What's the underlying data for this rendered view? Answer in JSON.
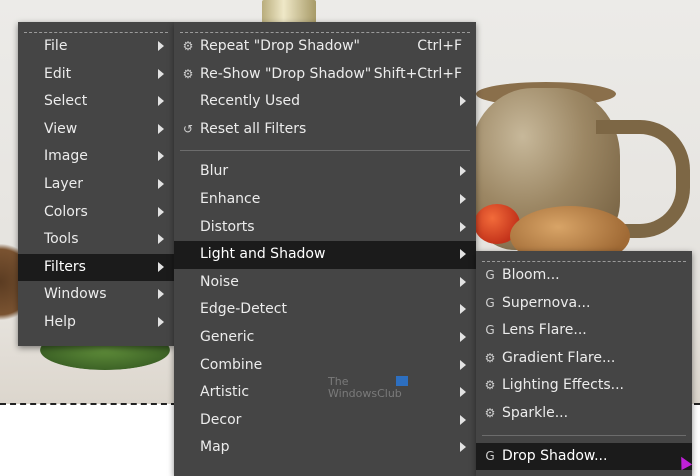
{
  "main_menu": {
    "items": [
      {
        "label": "File",
        "submenu": true
      },
      {
        "label": "Edit",
        "submenu": true
      },
      {
        "label": "Select",
        "submenu": true
      },
      {
        "label": "View",
        "submenu": true
      },
      {
        "label": "Image",
        "submenu": true
      },
      {
        "label": "Layer",
        "submenu": true
      },
      {
        "label": "Colors",
        "submenu": true
      },
      {
        "label": "Tools",
        "submenu": true
      },
      {
        "label": "Filters",
        "submenu": true,
        "active": true
      },
      {
        "label": "Windows",
        "submenu": true
      },
      {
        "label": "Help",
        "submenu": true
      }
    ]
  },
  "filters_menu": {
    "top_items": [
      {
        "label": "Repeat \"Drop Shadow\"",
        "shortcut": "Ctrl+F",
        "icon": "repeat-icon"
      },
      {
        "label": "Re-Show \"Drop Shadow\"",
        "shortcut": "Shift+Ctrl+F",
        "icon": "reshow-icon"
      },
      {
        "label": "Recently Used",
        "submenu": true
      },
      {
        "label": "Reset all Filters",
        "icon": "reset-icon"
      }
    ],
    "categories": [
      {
        "label": "Blur",
        "submenu": true
      },
      {
        "label": "Enhance",
        "submenu": true
      },
      {
        "label": "Distorts",
        "submenu": true
      },
      {
        "label": "Light and Shadow",
        "submenu": true,
        "active": true
      },
      {
        "label": "Noise",
        "submenu": true
      },
      {
        "label": "Edge-Detect",
        "submenu": true
      },
      {
        "label": "Generic",
        "submenu": true
      },
      {
        "label": "Combine",
        "submenu": true
      },
      {
        "label": "Artistic",
        "submenu": true
      },
      {
        "label": "Decor",
        "submenu": true
      },
      {
        "label": "Map",
        "submenu": true
      }
    ]
  },
  "light_shadow_menu": {
    "items": [
      {
        "label": "Bloom...",
        "icon": "gegl-icon"
      },
      {
        "label": "Supernova...",
        "icon": "gegl-icon"
      },
      {
        "label": "Lens Flare...",
        "icon": "gegl-icon"
      },
      {
        "label": "Gradient Flare...",
        "icon": "plugin-icon"
      },
      {
        "label": "Lighting Effects...",
        "icon": "plugin-icon"
      },
      {
        "label": "Sparkle...",
        "icon": "plugin-icon"
      }
    ],
    "bottom_items": [
      {
        "label": "Drop Shadow...",
        "icon": "gegl-icon",
        "active": true
      }
    ]
  },
  "watermark": {
    "line1": "The",
    "line2": "WindowsClub"
  },
  "colors": {
    "menu_bg": "#454545",
    "menu_active_bg": "#1b1b1b",
    "menu_text": "#ececec",
    "cursor": "#c020d8"
  }
}
